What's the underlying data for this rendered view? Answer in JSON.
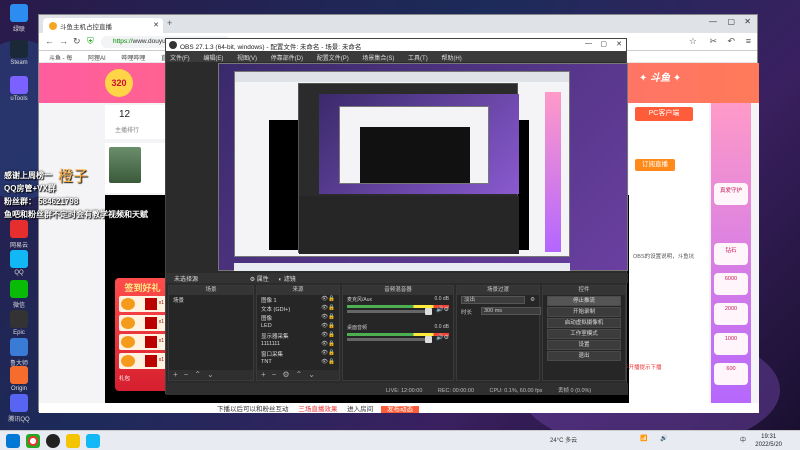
{
  "desktop": {
    "icons": [
      {
        "label": "绿联"
      },
      {
        "label": "Steam"
      },
      {
        "label": "uTools"
      },
      {
        "label": "网易云"
      },
      {
        "label": "QQ"
      },
      {
        "label": "微信"
      },
      {
        "label": "Epic"
      },
      {
        "label": "鲁大师"
      },
      {
        "label": "Origin"
      },
      {
        "label": "Discord"
      },
      {
        "label": "腾讯QQ"
      }
    ]
  },
  "overlay": {
    "line1_prefix": "感谢上周榜一",
    "line1_name": "橙子",
    "line2": "QQ房管+VX群",
    "line3": "粉丝群：  584621798",
    "line4": "鱼吧和粉丝群不定时会有教学视频和天赋"
  },
  "browser": {
    "tab_title": "斗鱼主机占控直播",
    "address_secure": "https://",
    "address_host": "www.douyu.",
    "bookmarks": [
      "斗鱼 - 每",
      "阿狸AI",
      "哔哩哔哩",
      "直播"
    ],
    "page": {
      "stat_number": "12",
      "stat_label": "主播排行",
      "streamer_name": "阿狸",
      "pc_button": "PC客户端",
      "subscribe_button": "订阅直播",
      "side_items": [
        "真爱守护",
        "钻石",
        "6000",
        "2000",
        "1000",
        "600",
        "500",
        "400"
      ],
      "bottom_text": "下播以后可以和粉丝互动",
      "bottom_red": "三场直播效果",
      "bottom_link": "进入房间",
      "bottom_btn": "发布动态",
      "right_text1": "OBS的设置说明，斗鱼坑",
      "right_text2": "不开播提示下播"
    }
  },
  "signin": {
    "title": "签到好礼",
    "rewards": [
      "x1",
      "x1",
      "x1",
      "x1",
      "x1"
    ],
    "footer": "礼包"
  },
  "obs": {
    "title": "OBS 27.1.3 (64-bit, windows) - 配置文件: 未命名 - 场景: 未命名",
    "menu": [
      "文件(F)",
      "编辑(E)",
      "视图(V)",
      "停靠部件(D)",
      "配置文件(P)",
      "场景集合(S)",
      "工具(T)",
      "帮助(H)"
    ],
    "scene_header": "未选择源",
    "props_button": "属性",
    "filters_button": "滤镜",
    "docks": {
      "scenes_title": "场景",
      "scenes": [
        "场景"
      ],
      "sources_title": "来源",
      "sources": [
        "图像 1",
        "文本 (GDI+)",
        "图像",
        "LED",
        "显示器采集",
        "1111111",
        "窗口采集",
        "TNT"
      ],
      "mixer_title": "音频混音器",
      "mixer": [
        {
          "name": "麦克风/Aux",
          "db": "0.0 dB"
        },
        {
          "name": "桌面音频",
          "db": "0.0 dB"
        }
      ],
      "transitions_title": "场景过渡",
      "transition_label": "淡出",
      "duration_label": "时长",
      "duration_value": "300 ms",
      "controls_title": "控件",
      "controls": [
        "停止推流",
        "开始录制",
        "启动虚拟摄像机",
        "工作室模式",
        "设置",
        "退出"
      ]
    },
    "status": {
      "live": "LIVE: 12:00:00",
      "rec": "REC: 00:00:00",
      "cpu": "CPU: 0.1%, 60.00 fps",
      "dropped": "丢帧 0 (0.0%)"
    }
  },
  "taskbar": {
    "weather": "24°C 多云",
    "time": "19:31",
    "date": "2022/5/20",
    "ime": "中"
  }
}
